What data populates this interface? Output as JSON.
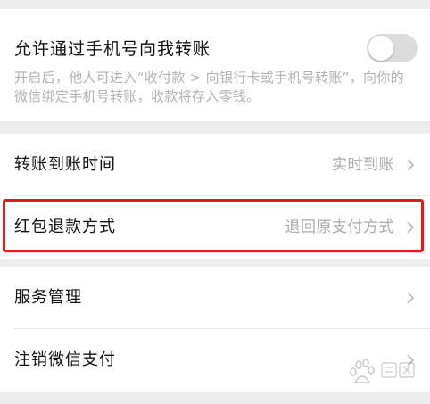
{
  "toggle_section": {
    "title": "允许通过手机号向我转账",
    "description": "开启后，他人可进入“收付款 > 向银行卡或手机号转账”，向你的微信绑定手机号转账，收款将存入零钱。",
    "enabled": false
  },
  "settings": {
    "transfer_time": {
      "label": "转账到账时间",
      "value": "实时到账"
    },
    "refund_method": {
      "label": "红包退款方式",
      "value": "退回原支付方式"
    }
  },
  "more": {
    "service_management": {
      "label": "服务管理"
    },
    "cancel_wechat_pay": {
      "label": "注销微信支付"
    }
  },
  "colors": {
    "highlight_border": "#e6171e",
    "page_background": "#ededed",
    "muted_text": "#a9a9a9"
  },
  "icons": {
    "chevron": "chevron-right-icon",
    "watermark": "baidu-jingyan-watermark"
  }
}
